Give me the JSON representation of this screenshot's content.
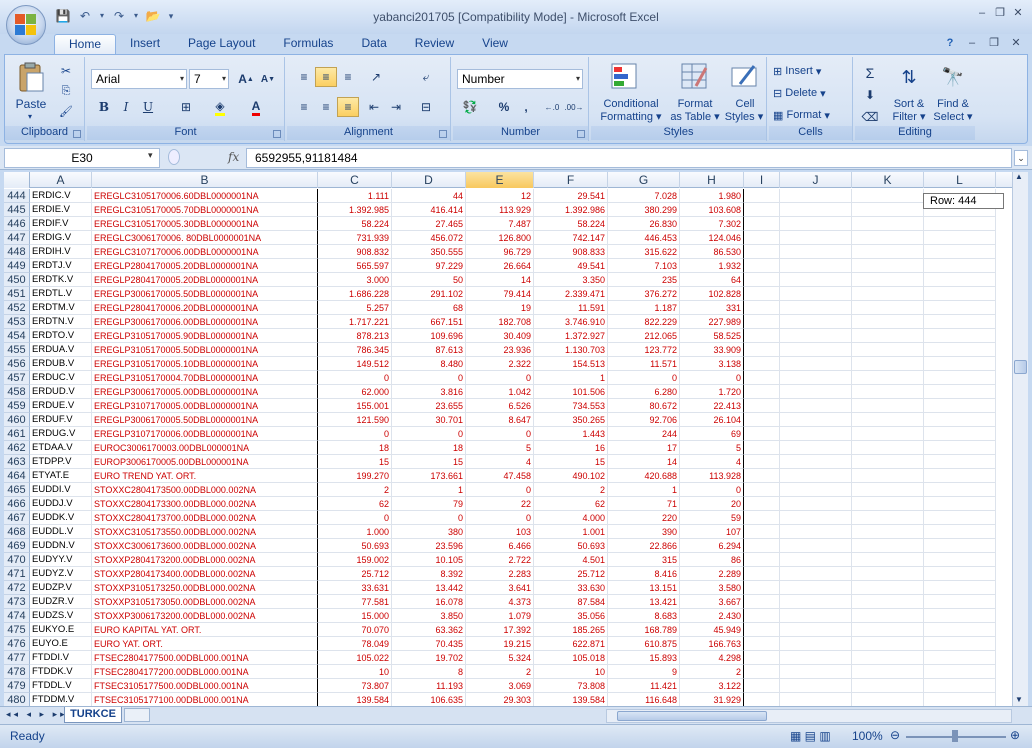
{
  "window": {
    "title": "yabanci201705  [Compatibility Mode] - Microsoft Excel",
    "controls": [
      "–",
      "❐",
      "✕"
    ]
  },
  "ribbon": {
    "tabs": [
      "Home",
      "Insert",
      "Page Layout",
      "Formulas",
      "Data",
      "Review",
      "View"
    ],
    "active_tab": "Home",
    "clipboard": {
      "label": "Clipboard",
      "paste": "Paste"
    },
    "font": {
      "label": "Font",
      "name": "Arial",
      "size": "7"
    },
    "alignment": {
      "label": "Alignment"
    },
    "number": {
      "label": "Number",
      "format": "Number",
      "percent": "%",
      "comma": ","
    },
    "styles": {
      "label": "Styles",
      "conditional": "Conditional",
      "formatting": "Formatting",
      "format": "Format",
      "as_table": "as Table",
      "cell": "Cell",
      "styles_btn": "Styles"
    },
    "cells": {
      "label": "Cells",
      "insert": "Insert",
      "delete": "Delete",
      "format": "Format"
    },
    "editing": {
      "label": "Editing",
      "sort": "Sort &",
      "filter": "Filter",
      "find": "Find &",
      "select": "Select"
    }
  },
  "formula_bar": {
    "name_box": "E30",
    "fx": "fx",
    "content": "6592955,91181484"
  },
  "columns": [
    "A",
    "B",
    "C",
    "D",
    "E",
    "F",
    "G",
    "H",
    "I",
    "J",
    "K",
    "L"
  ],
  "selected_column": "E",
  "tooltip": "Row: 444",
  "rows": [
    [
      "444",
      "ERDIC.V",
      "EREGLC3105170006.60DBL0000001NA",
      "1.111",
      "44",
      "12",
      "29.541",
      "7.028",
      "1.980"
    ],
    [
      "445",
      "ERDIE.V",
      "EREGLC3105170005.70DBL0000001NA",
      "1.392.985",
      "416.414",
      "113.929",
      "1.392.986",
      "380.299",
      "103.608"
    ],
    [
      "446",
      "ERDIF.V",
      "EREGLC3105170005.30DBL0000001NA",
      "58.224",
      "27.465",
      "7.487",
      "58.224",
      "26.830",
      "7.302"
    ],
    [
      "447",
      "ERDIG.V",
      "EREGLC3006170006. 80DBL0000001NA",
      "731.939",
      "456.072",
      "126.800",
      "742.147",
      "446.453",
      "124.046"
    ],
    [
      "448",
      "ERDIH.V",
      "EREGLC3107170006.00DBL0000001NA",
      "908.832",
      "350.555",
      "96.729",
      "908.833",
      "315.622",
      "86.530"
    ],
    [
      "449",
      "ERDTJ.V",
      "EREGLP2804170005.20DBL0000001NA",
      "565.597",
      "97.229",
      "26.664",
      "49.541",
      "7.103",
      "1.932"
    ],
    [
      "450",
      "ERDTK.V",
      "EREGLP2804170005.20DBL0000001NA",
      "3.000",
      "50",
      "14",
      "3.350",
      "235",
      "64"
    ],
    [
      "451",
      "ERDTL.V",
      "EREGLP3006170005.50DBL0000001NA",
      "1.686.228",
      "291.102",
      "79.414",
      "2.339.471",
      "376.272",
      "102.828"
    ],
    [
      "452",
      "ERDTM.V",
      "EREGLP2804170006.20DBL0000001NA",
      "5.257",
      "68",
      "19",
      "11.591",
      "1.187",
      "331"
    ],
    [
      "453",
      "ERDTN.V",
      "EREGLP3006170006.00DBL0000001NA",
      "1.717.221",
      "667.151",
      "182.708",
      "3.746.910",
      "822.229",
      "227.989"
    ],
    [
      "454",
      "ERDTO.V",
      "EREGLP3105170005.90DBL0000001NA",
      "878.213",
      "109.696",
      "30.409",
      "1.372.927",
      "212.065",
      "58.525"
    ],
    [
      "455",
      "ERDUA.V",
      "EREGLP3105170005.50DBL0000001NA",
      "786.345",
      "87.613",
      "23.936",
      "1.130.703",
      "123.772",
      "33.909"
    ],
    [
      "456",
      "ERDUB.V",
      "EREGLP3105170005.10DBL0000001NA",
      "149.512",
      "8.480",
      "2.322",
      "154.513",
      "11.571",
      "3.138"
    ],
    [
      "457",
      "ERDUC.V",
      "EREGLP3105170004.70DBL0000001NA",
      "0",
      "0",
      "0",
      "1",
      "0",
      "0"
    ],
    [
      "458",
      "ERDUD.V",
      "EREGLP3006170005.00DBL0000001NA",
      "62.000",
      "3.816",
      "1.042",
      "101.506",
      "6.280",
      "1.720"
    ],
    [
      "459",
      "ERDUE.V",
      "EREGLP3107170005.00DBL0000001NA",
      "155.001",
      "23.655",
      "6.526",
      "734.553",
      "80.672",
      "22.413"
    ],
    [
      "460",
      "ERDUF.V",
      "EREGLP3006170005.50DBL0000001NA",
      "121.590",
      "30.701",
      "8.647",
      "350.265",
      "92.706",
      "26.104"
    ],
    [
      "461",
      "ERDUG.V",
      "EREGLP3107170006.00DBL0000001NA",
      "0",
      "0",
      "0",
      "1.443",
      "244",
      "69"
    ],
    [
      "462",
      "ETDAA.V",
      "EUROC3006170003.00DBL000001NA",
      "18",
      "18",
      "5",
      "16",
      "17",
      "5"
    ],
    [
      "463",
      "ETDPP.V",
      "EUROP3006170005.00DBL000001NA",
      "15",
      "15",
      "4",
      "15",
      "14",
      "4"
    ],
    [
      "464",
      "ETYAT.E",
      "EURO TREND YAT. ORT.",
      "199.270",
      "173.661",
      "47.458",
      "490.102",
      "420.688",
      "113.928"
    ],
    [
      "465",
      "EUDDI.V",
      "STOXXC2804173500.00DBL000.002NA",
      "2",
      "1",
      "0",
      "2",
      "1",
      "0"
    ],
    [
      "466",
      "EUDDJ.V",
      "STOXXC2804173300.00DBL000.002NA",
      "62",
      "79",
      "22",
      "62",
      "71",
      "20"
    ],
    [
      "467",
      "EUDDK.V",
      "STOXXC2804173700.00DBL000.002NA",
      "0",
      "0",
      "0",
      "4.000",
      "220",
      "59"
    ],
    [
      "468",
      "EUDDL.V",
      "STOXXC3105173550.00DBL000.002NA",
      "1.000",
      "380",
      "103",
      "1.001",
      "390",
      "107"
    ],
    [
      "469",
      "EUDDN.V",
      "STOXXC3006173600.00DBL000.002NA",
      "50.693",
      "23.596",
      "6.466",
      "50.693",
      "22.866",
      "6.294"
    ],
    [
      "470",
      "EUDYY.V",
      "STOXXP2804173200.00DBL000.002NA",
      "159.002",
      "10.105",
      "2.722",
      "4.501",
      "315",
      "86"
    ],
    [
      "471",
      "EUDYZ.V",
      "STOXXP2804173400.00DBL000.002NA",
      "25.712",
      "8.392",
      "2.283",
      "25.712",
      "8.416",
      "2.289"
    ],
    [
      "472",
      "EUDZP.V",
      "STOXXP3105173250.00DBL000.002NA",
      "33.631",
      "13.442",
      "3.641",
      "33.630",
      "13.151",
      "3.580"
    ],
    [
      "473",
      "EUDZR.V",
      "STOXXP3105173050.00DBL000.002NA",
      "77.581",
      "16.078",
      "4.373",
      "87.584",
      "13.421",
      "3.667"
    ],
    [
      "474",
      "EUDZS.V",
      "STOXXP3006173200.00DBL000.002NA",
      "15.000",
      "3.850",
      "1.079",
      "35.056",
      "8.683",
      "2.430"
    ],
    [
      "475",
      "EUKYO.E",
      "EURO KAPITAL YAT. ORT.",
      "70.070",
      "63.362",
      "17.392",
      "185.265",
      "168.789",
      "45.949"
    ],
    [
      "476",
      "EUYO.E",
      "EURO YAT. ORT.",
      "78.049",
      "70.435",
      "19.215",
      "622.871",
      "610.875",
      "166.763"
    ],
    [
      "477",
      "FTDDI.V",
      "FTSEC2804177500.00DBL000.001NA",
      "105.022",
      "19.702",
      "5.324",
      "105.018",
      "15.893",
      "4.298"
    ],
    [
      "478",
      "FTDDK.V",
      "FTSEC2804177200.00DBL000.001NA",
      "10",
      "8",
      "2",
      "10",
      "9",
      "2"
    ],
    [
      "479",
      "FTDDL.V",
      "FTSEC3105177500.00DBL000.001NA",
      "73.807",
      "11.193",
      "3.069",
      "73.808",
      "11.421",
      "3.122"
    ],
    [
      "480",
      "FTDDM.V",
      "FTSEC3105177100.00DBL000.001NA",
      "139.584",
      "106.635",
      "29.303",
      "139.584",
      "116.648",
      "31.929"
    ]
  ],
  "sheet_tab": "TURKCE",
  "status": {
    "text": "Ready",
    "zoom": "100%"
  },
  "colors": {
    "accent": "#15428b",
    "data_red": "#c00000",
    "ribbon_bg": "#dbe7f6"
  }
}
